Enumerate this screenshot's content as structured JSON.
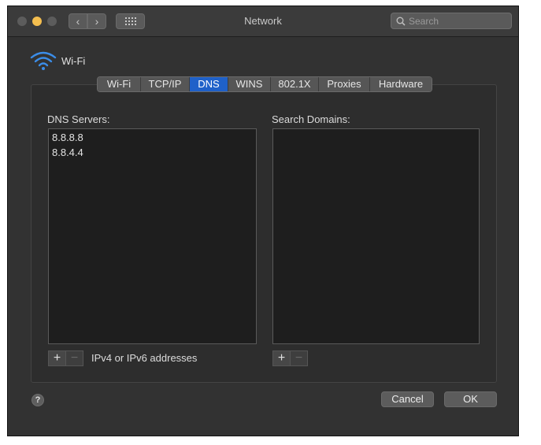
{
  "window": {
    "title": "Network",
    "search_placeholder": "Search",
    "back_glyph": "‹",
    "forward_glyph": "›"
  },
  "service": {
    "name": "Wi-Fi",
    "icon": "wifi-icon"
  },
  "tabs": [
    {
      "label": "Wi-Fi",
      "active": false
    },
    {
      "label": "TCP/IP",
      "active": false
    },
    {
      "label": "DNS",
      "active": true
    },
    {
      "label": "WINS",
      "active": false
    },
    {
      "label": "802.1X",
      "active": false
    },
    {
      "label": "Proxies",
      "active": false
    },
    {
      "label": "Hardware",
      "active": false
    }
  ],
  "dns": {
    "label": "DNS Servers:",
    "servers": [
      "8.8.8.8",
      "8.8.4.4"
    ],
    "hint": "IPv4 or IPv6 addresses"
  },
  "search_domains": {
    "label": "Search Domains:",
    "domains": []
  },
  "controls": {
    "plus": "+",
    "minus": "−"
  },
  "buttons": {
    "help": "?",
    "cancel": "Cancel",
    "ok": "OK"
  },
  "colors": {
    "accent": "#1f61c9",
    "minimize": "#f4be4f",
    "wifi": "#3b8de8"
  }
}
